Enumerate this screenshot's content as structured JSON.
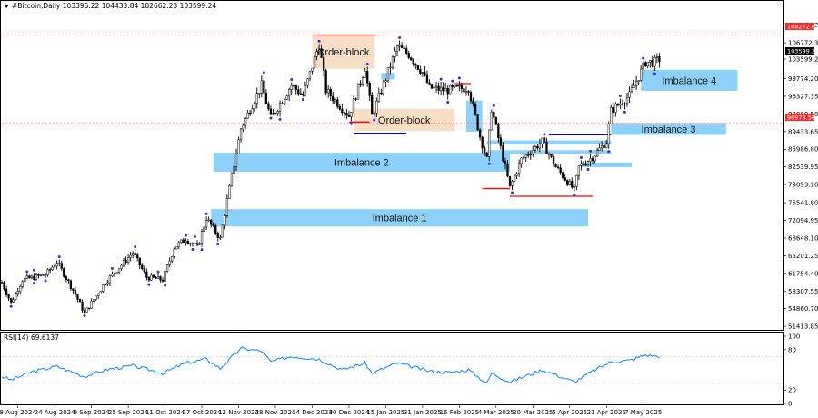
{
  "header": {
    "icon": "triangle-down-icon",
    "symbol_text": "#Bitcoin,Daily  103396.22 104433.84 102662.23 103599.24"
  },
  "rsi_header": "RSI(14) 69.6137",
  "price_badges": {
    "upper_line": "108272.88",
    "current": "103599.24",
    "lower_line": "90978.58"
  },
  "colors": {
    "candle": "#000000",
    "imbalance": "#87cefa",
    "order_block": "#f5dcc0",
    "level_red": "#ff0000",
    "level_blue": "#0000c8",
    "fractal": "#3a2bd6",
    "rsi_line": "#1e90ff",
    "badge_red": "#ff2a2a",
    "badge_black": "#000000"
  },
  "zones": [
    {
      "label": "Order-block",
      "kind": "order_block",
      "x0": "2024-12-14",
      "x1": "2025-01-10",
      "top": 108250,
      "bottom": 101700
    },
    {
      "label": "Order-block",
      "kind": "order_block",
      "x0": "2025-01-01",
      "x1": "2025-02-14",
      "top": 93900,
      "bottom": 89500
    },
    {
      "label": "Imbalance 2",
      "kind": "imbalance",
      "x0": "2024-11-01",
      "x1": "2025-03-10",
      "top": 85300,
      "bottom": 81600
    },
    {
      "label": "Imbalance 1",
      "kind": "imbalance",
      "x0": "2024-10-31",
      "x1": "2025-04-13",
      "top": 74300,
      "bottom": 70900
    },
    {
      "label": "Imbalance 3",
      "kind": "imbalance",
      "x0": "2025-04-23",
      "x1": "2025-06-12",
      "top": 91100,
      "bottom": 88800
    },
    {
      "label": "Imbalance 4",
      "kind": "imbalance",
      "x0": "2025-05-06",
      "x1": "2025-06-17",
      "top": 101500,
      "bottom": 97400
    },
    {
      "label": "",
      "kind": "imbalance",
      "x0": "2025-02-19",
      "x1": "2025-02-26",
      "top": 95500,
      "bottom": 89400
    },
    {
      "label": "",
      "kind": "imbalance",
      "x0": "2025-01-13",
      "x1": "2025-01-19",
      "top": 100900,
      "bottom": 99600
    },
    {
      "label": "",
      "kind": "imbalance",
      "x0": "2025-02-28",
      "x1": "2025-04-23",
      "top": 87700,
      "bottom": 86900
    },
    {
      "label": "",
      "kind": "imbalance",
      "x0": "2025-02-28",
      "x1": "2025-04-23",
      "top": 85800,
      "bottom": 85100
    },
    {
      "label": "",
      "kind": "imbalance",
      "x0": "2025-04-10",
      "x1": "2025-05-02",
      "top": 83400,
      "bottom": 82500
    }
  ],
  "levels": [
    {
      "color": "red",
      "price": 108300,
      "x0": "2024-12-15",
      "x1": "2025-01-11"
    },
    {
      "color": "red",
      "price": 91300,
      "x0": "2024-12-30",
      "x1": "2025-01-08"
    },
    {
      "color": "blue",
      "price": 89100,
      "x0": "2025-01-01",
      "x1": "2025-01-24"
    },
    {
      "color": "red",
      "price": 98800,
      "x0": "2025-02-14",
      "x1": "2025-02-21"
    },
    {
      "color": "red",
      "price": 78300,
      "x0": "2025-02-26",
      "x1": "2025-03-10"
    },
    {
      "color": "red",
      "price": 76800,
      "x0": "2025-03-10",
      "x1": "2025-04-15"
    },
    {
      "color": "blue",
      "price": 88800,
      "x0": "2025-03-27",
      "x1": "2025-04-23"
    }
  ],
  "dotted_levels": [
    108272.88,
    90978.58
  ],
  "chart_data": [
    {
      "type": "candlestick",
      "title": "#Bitcoin,Daily",
      "series_name": "",
      "x_range": [
        "2024-08-01",
        "2025-07-07"
      ],
      "ylim": [
        50900,
        113000
      ],
      "yticks": [
        "110219.20",
        "106772.35",
        "103599.24",
        "99774.20",
        "96327.35",
        "92880.50",
        "89433.65",
        "85986.80",
        "82539.95",
        "79093.10",
        "75541.80",
        "72094.95",
        "68648.10",
        "65201.25",
        "61754.40",
        "58307.55",
        "54860.70",
        "51413.85"
      ],
      "xticks": [
        "8 Aug 2024",
        "24 Aug 2024",
        "9 Sep 2024",
        "25 Sep 2024",
        "11 Oct 2024",
        "27 Oct 2024",
        "12 Nov 2024",
        "28 Nov 2024",
        "14 Dec 2024",
        "30 Dec 2024",
        "15 Jan 2025",
        "31 Jan 2025",
        "16 Feb 2025",
        "4 Mar 2025",
        "20 Mar 2025",
        "5 Apr 2025",
        "21 Apr 2025",
        "7 May 2025"
      ],
      "xtick_dates": [
        "2024-08-08",
        "2024-08-24",
        "2024-09-09",
        "2024-09-25",
        "2024-10-11",
        "2024-10-27",
        "2024-11-12",
        "2024-11-28",
        "2024-12-14",
        "2024-12-30",
        "2025-01-15",
        "2025-01-31",
        "2025-02-16",
        "2025-03-04",
        "2025-03-20",
        "2025-04-05",
        "2025-04-21",
        "2025-05-07"
      ],
      "key_closes": [
        [
          "2024-08-01",
          60000
        ],
        [
          "2024-08-05",
          56000
        ],
        [
          "2024-08-10",
          60500
        ],
        [
          "2024-08-20",
          61500
        ],
        [
          "2024-08-25",
          64000
        ],
        [
          "2024-09-01",
          58500
        ],
        [
          "2024-09-06",
          54000
        ],
        [
          "2024-09-15",
          60000
        ],
        [
          "2024-09-27",
          65800
        ],
        [
          "2024-10-03",
          61000
        ],
        [
          "2024-10-10",
          60500
        ],
        [
          "2024-10-15",
          66800
        ],
        [
          "2024-10-20",
          68500
        ],
        [
          "2024-10-25",
          66800
        ],
        [
          "2024-10-29",
          72500
        ],
        [
          "2024-11-04",
          68500
        ],
        [
          "2024-11-07",
          76000
        ],
        [
          "2024-11-13",
          90000
        ],
        [
          "2024-11-22",
          98500
        ],
        [
          "2024-11-26",
          92000
        ],
        [
          "2024-12-05",
          98500
        ],
        [
          "2024-12-10",
          96500
        ],
        [
          "2024-12-17",
          106500
        ],
        [
          "2024-12-20",
          97500
        ],
        [
          "2024-12-27",
          94000
        ],
        [
          "2024-12-30",
          92500
        ],
        [
          "2025-01-06",
          102000
        ],
        [
          "2025-01-09",
          92500
        ],
        [
          "2025-01-20",
          106000
        ],
        [
          "2025-01-25",
          104500
        ],
        [
          "2025-01-31",
          101000
        ],
        [
          "2025-02-03",
          98000
        ],
        [
          "2025-02-10",
          97500
        ],
        [
          "2025-02-20",
          98000
        ],
        [
          "2025-02-25",
          88500
        ],
        [
          "2025-02-28",
          84000
        ],
        [
          "2025-03-02",
          94000
        ],
        [
          "2025-03-10",
          78500
        ],
        [
          "2025-03-15",
          84000
        ],
        [
          "2025-03-24",
          87500
        ],
        [
          "2025-03-30",
          82500
        ],
        [
          "2025-04-07",
          78000
        ],
        [
          "2025-04-09",
          82500
        ],
        [
          "2025-04-15",
          84500
        ],
        [
          "2025-04-21",
          87500
        ],
        [
          "2025-04-23",
          93500
        ],
        [
          "2025-05-01",
          96500
        ],
        [
          "2025-05-08",
          103000
        ],
        [
          "2025-05-12",
          103000
        ],
        [
          "2025-05-14",
          103600
        ]
      ],
      "key_rsi": [
        [
          "2024-08-01",
          40
        ],
        [
          "2024-08-05",
          35
        ],
        [
          "2024-08-14",
          47
        ],
        [
          "2024-08-25",
          55
        ],
        [
          "2024-09-06",
          40
        ],
        [
          "2024-09-15",
          50
        ],
        [
          "2024-09-27",
          56
        ],
        [
          "2024-10-10",
          45
        ],
        [
          "2024-10-20",
          60
        ],
        [
          "2024-10-29",
          66
        ],
        [
          "2024-11-04",
          52
        ],
        [
          "2024-11-13",
          82
        ],
        [
          "2024-11-22",
          78
        ],
        [
          "2024-11-26",
          62
        ],
        [
          "2024-12-05",
          70
        ],
        [
          "2024-12-17",
          66
        ],
        [
          "2024-12-27",
          50
        ],
        [
          "2025-01-06",
          60
        ],
        [
          "2025-01-09",
          45
        ],
        [
          "2025-01-20",
          60
        ],
        [
          "2025-02-03",
          48
        ],
        [
          "2025-02-12",
          46
        ],
        [
          "2025-02-20",
          50
        ],
        [
          "2025-02-28",
          30
        ],
        [
          "2025-03-02",
          45
        ],
        [
          "2025-03-10",
          32
        ],
        [
          "2025-03-24",
          50
        ],
        [
          "2025-04-07",
          32
        ],
        [
          "2025-04-15",
          48
        ],
        [
          "2025-04-23",
          62
        ],
        [
          "2025-05-01",
          64
        ],
        [
          "2025-05-08",
          72
        ],
        [
          "2025-05-14",
          69.6
        ]
      ],
      "rsi": {
        "label": "RSI(14) 69.6137",
        "ylim": [
          0,
          100
        ],
        "ticks": [
          "100",
          "80",
          "20",
          "0"
        ],
        "levels": [
          30,
          70
        ]
      }
    }
  ]
}
